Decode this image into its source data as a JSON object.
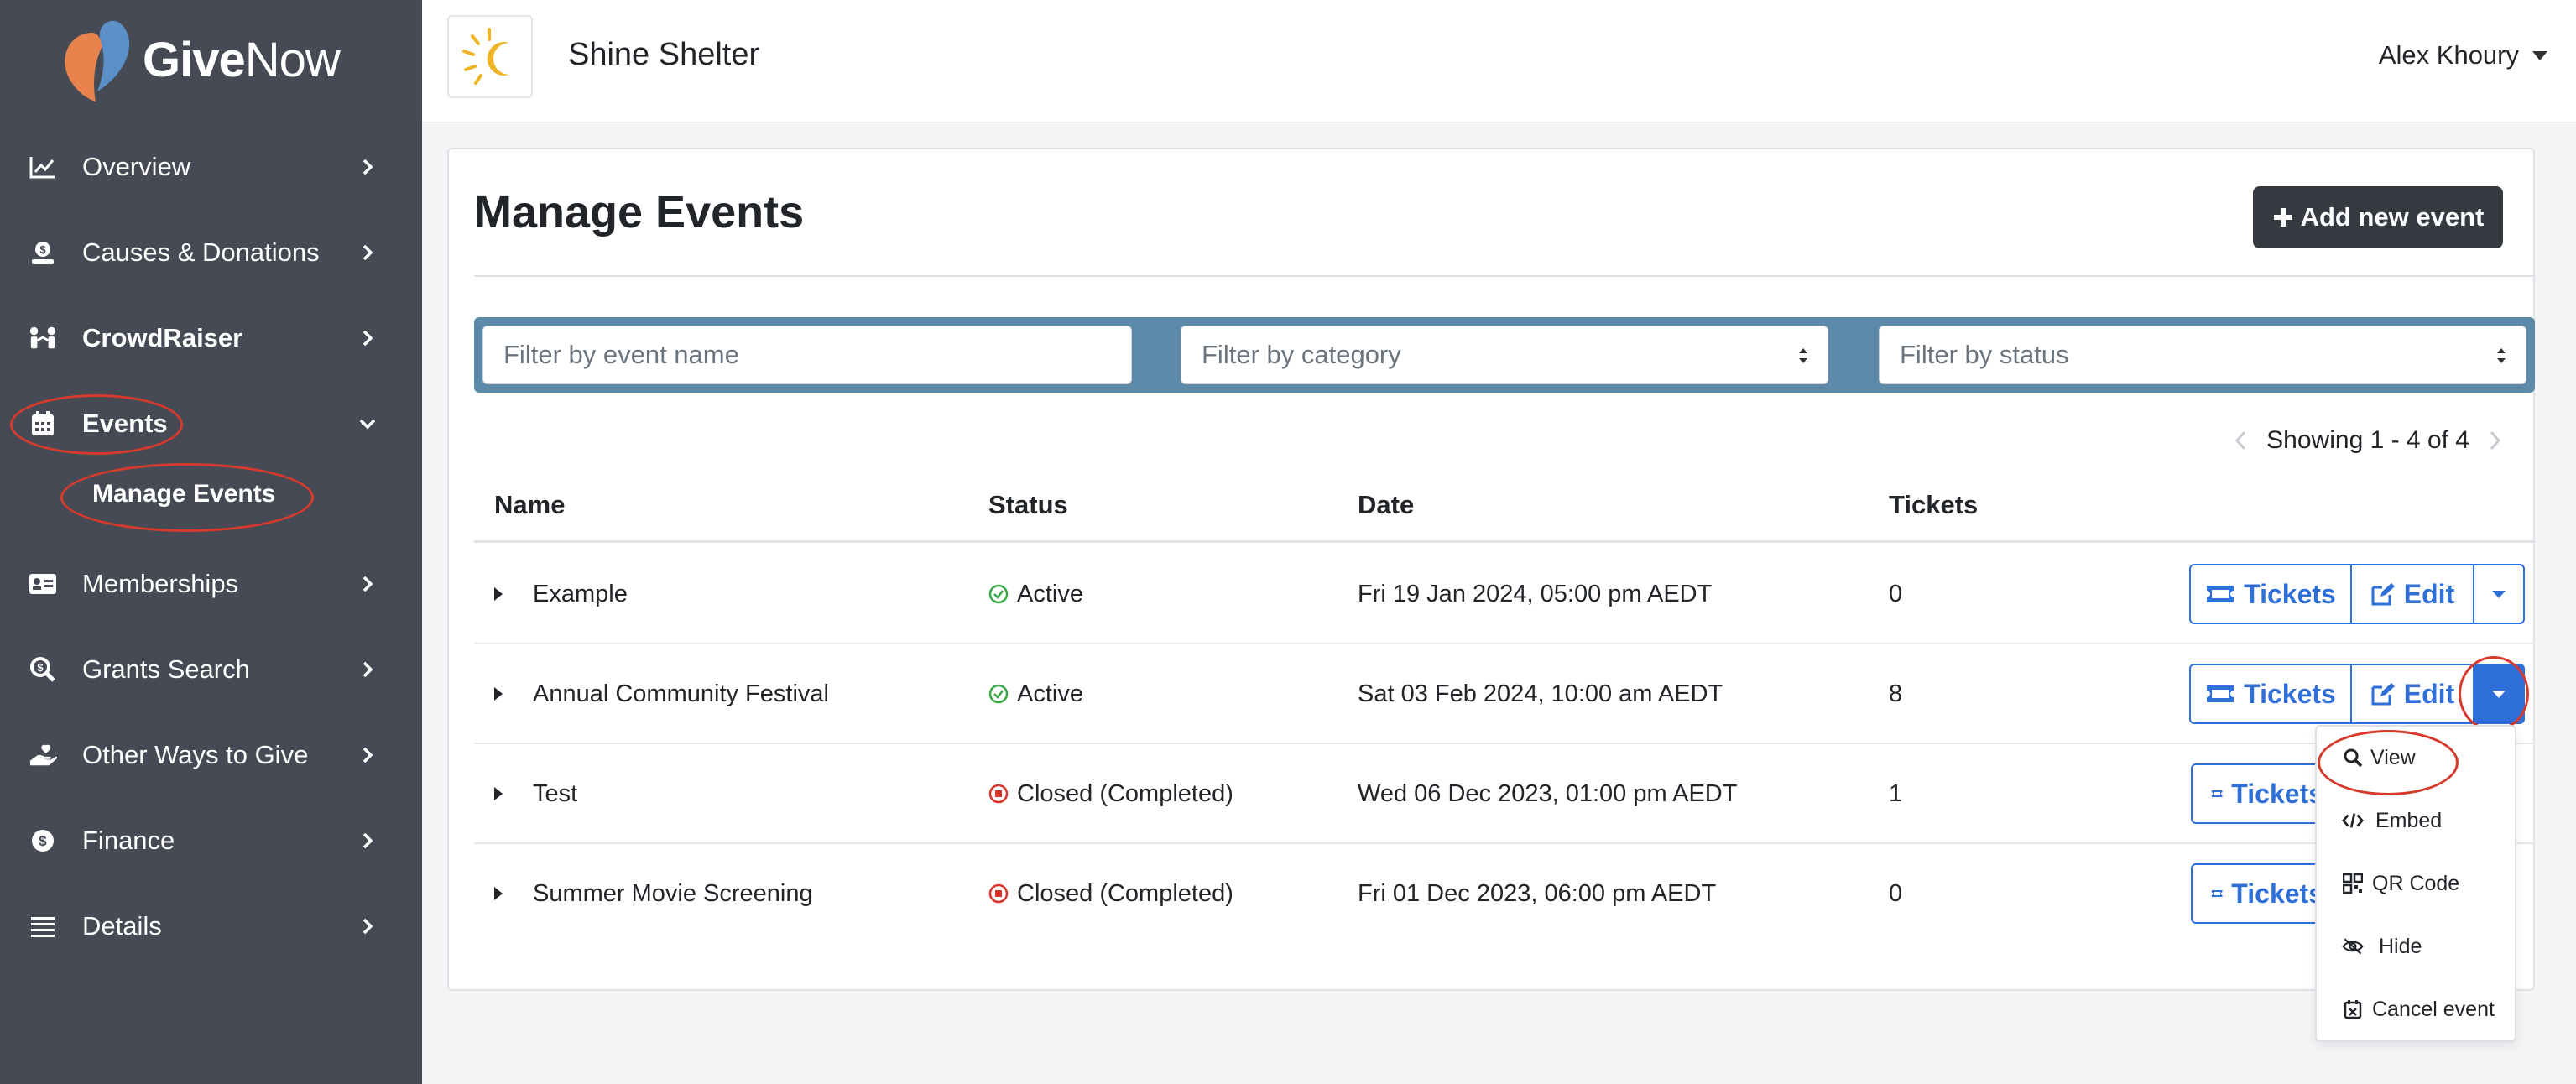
{
  "brand": {
    "logo_give": "Give",
    "logo_now": "Now"
  },
  "sidebar": {
    "items": [
      {
        "label": "Overview",
        "icon": "chart-line-icon"
      },
      {
        "label": "Causes & Donations",
        "icon": "donation-icon"
      },
      {
        "label": "CrowdRaiser",
        "icon": "people-icon"
      },
      {
        "label": "Events",
        "icon": "calendar-icon",
        "expanded": true
      },
      {
        "label": "Memberships",
        "icon": "id-card-icon"
      },
      {
        "label": "Grants Search",
        "icon": "search-dollar-icon"
      },
      {
        "label": "Other Ways to Give",
        "icon": "hand-heart-icon"
      },
      {
        "label": "Finance",
        "icon": "dollar-circle-icon"
      },
      {
        "label": "Details",
        "icon": "list-icon"
      }
    ],
    "sub_item": "Manage Events"
  },
  "header": {
    "org_name": "Shine Shelter",
    "user_name": "Alex Khoury"
  },
  "main": {
    "title": "Manage Events",
    "add_button": "Add new event",
    "filters": {
      "name_placeholder": "Filter by event name",
      "category_placeholder": "Filter by category",
      "status_placeholder": "Filter by status"
    },
    "pager": "Showing 1 - 4 of 4",
    "columns": [
      "Name",
      "Status",
      "Date",
      "Tickets"
    ],
    "rows": [
      {
        "name": "Example",
        "status": "Active",
        "date": "Fri 19 Jan 2024, 05:00 pm AEDT",
        "tickets": "0"
      },
      {
        "name": "Annual Community Festival",
        "status": "Active",
        "date": "Sat 03 Feb 2024, 10:00 am AEDT",
        "tickets": "8"
      },
      {
        "name": "Test",
        "status": "Closed (Completed)",
        "date": "Wed 06 Dec 2023, 01:00 pm AEDT",
        "tickets": "1"
      },
      {
        "name": "Summer Movie Screening",
        "status": "Closed (Completed)",
        "date": "Fri 01 Dec 2023, 06:00 pm AEDT",
        "tickets": "0"
      }
    ],
    "row_buttons": {
      "tickets": "Tickets",
      "edit": "Edit"
    },
    "dropdown_menu": [
      "View",
      "Embed",
      "QR Code",
      "Hide",
      "Cancel event"
    ]
  },
  "colors": {
    "sidebar_bg": "#464a54",
    "accent_blue": "#2f6fd8",
    "filter_bar": "#5d8aa8",
    "annotation_red": "#d63a2c",
    "status_active": "#3aa845",
    "status_closed": "#d9342b"
  }
}
